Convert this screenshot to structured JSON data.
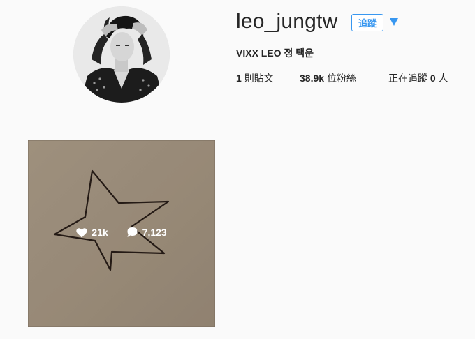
{
  "profile": {
    "username": "leo_jungtw",
    "full_name": "VIXX LEO 정 택운",
    "follow_label": "追蹤",
    "accent_color": "#3897f0"
  },
  "stats": {
    "posts_count": "1",
    "posts_label": "則貼文",
    "followers_count": "38.9k",
    "followers_label": "位粉絲",
    "following_prefix": "正在追蹤",
    "following_count": "0",
    "following_suffix": "人"
  },
  "posts": [
    {
      "likes": "21k",
      "comments": "7,123",
      "like_icon": "heart-icon",
      "comment_icon": "speech-bubble-icon"
    }
  ]
}
